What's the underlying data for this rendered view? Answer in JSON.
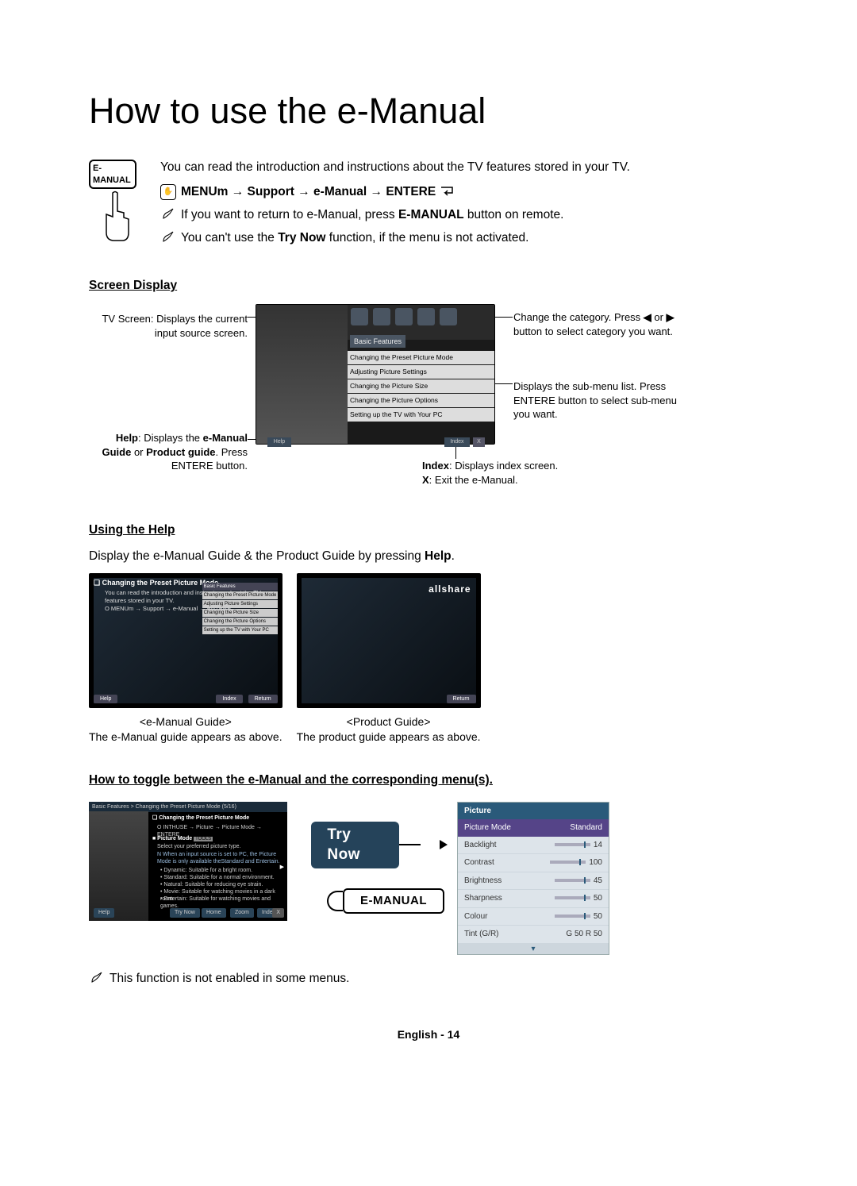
{
  "title": "How to use the e-Manual",
  "intro": "You can read the introduction and instructions about the TV features stored in your TV.",
  "badge": "E-MANUAL",
  "path": {
    "prefix": "O",
    "menu": "MENU",
    "m": "m",
    "arrow": " → ",
    "s1": "Support",
    "s2": "e-Manual",
    "enter": "ENTER",
    "e": "E"
  },
  "path_full": "MENUm → Support → e-Manual → ENTERE",
  "note1_a": "If you want to return to e-Manual, press ",
  "note1_b": "E-MANUAL",
  "note1_c": " button on remote.",
  "note2_a": "You can't use the ",
  "note2_b": "Try Now",
  "note2_c": " function, if the menu is not activated.",
  "sec1": "Screen Display",
  "basic": "Basic Features",
  "rows": {
    "r1": "Changing the Preset Picture Mode",
    "r2": "Adjusting Picture Settings",
    "r3": "Changing the Picture Size",
    "r4": "Changing the Picture Options",
    "r5": "Setting up the TV with Your PC"
  },
  "help_lbl": "Help",
  "index_lbl": "Index",
  "x_lbl": "X",
  "call_tv_a": "TV Screen: Displays the current input source screen.",
  "call_help_a": "Help",
  "call_help_b": ": Displays the ",
  "call_help_c": "e-Manual Guide",
  "call_help_d": " or ",
  "call_help_e": "Product guide",
  "call_help_f": ". Press ENTER",
  "call_help_g": "E",
  "call_help_h": " button.",
  "call_cat_a": "Change the category. Press ",
  "call_cat_b": "l",
  "call_cat_c": " or ",
  "call_cat_d": "r",
  "call_cat_e": " button to select category you want.",
  "call_sub_a": "Displays the sub-menu list. Press ENTER",
  "call_sub_b": "E",
  "call_sub_c": " button to select sub-menu you want.",
  "call_idx_a": "Index",
  "call_idx_b": ": Displays index screen.",
  "call_idx_c": "X",
  "call_idx_d": ": Exit the e-Manual.",
  "sec2": "Using the Help",
  "sec2_sub_a": "Display the e-Manual Guide & the Product Guide by pressing ",
  "sec2_sub_b": "Help",
  "sec2_sub_c": ".",
  "panelA": {
    "title": "❑ Changing the Preset Picture Mode",
    "txt": "You can read the introduction and instructions about the TV features stored in your TV.",
    "path": "O MENUm → Support → e-Manual → ENTERE",
    "bf": "Basic Features",
    "r1": "Changing the Preset Picture Mode",
    "r2": "Adjusting Picture Settings",
    "r3": "Changing the Picture Size",
    "r4": "Changing the Picture Options",
    "r5": "Setting up the TV with Your PC",
    "help": "Help",
    "index": "Index",
    "return": "Return"
  },
  "panelB": {
    "brand": "allshare",
    "return": "Return"
  },
  "capA_tag": "<e-Manual Guide>",
  "capA_txt": "The e-Manual guide appears as above.",
  "capB_tag": "<Product Guide>",
  "capB_txt": "The product guide appears as above.",
  "sec3": "How to toggle between the e-Manual and the corresponding menu(s).",
  "miniE": {
    "crumb": "Basic Features > Changing the Preset Picture Mode (5/16)",
    "t": "❑ Changing the Preset Picture Mode",
    "p": "O INTHUSE → Picture → Picture Mode → ENTERE",
    "h": "■ Picture Mode",
    "tool": "TOOLS",
    "sel": "Select your preferred picture type.",
    "note": "N When an input source is set to PC, the Picture Mode is only available theStandard and Entertain.",
    "b1": "• Dynamic: Suitable for a bright room.",
    "b2": "• Standard: Suitable for a normal environment.",
    "b3": "• Natural: Suitable for reducing eye strain.",
    "b4": "• Movie: Suitable for watching movies in a dark room.",
    "b5": "• Entertain: Suitable for watching movies and games.",
    "btn_try": "Try Now",
    "btn_home": "Home",
    "btn_zoom": "Zoom",
    "btn_index": "Index",
    "btn_x": "X",
    "btn_help": "Help"
  },
  "pill_try": "Try Now",
  "pill_em": "E-MANUAL",
  "osd": {
    "head": "Picture",
    "sel_l": "Picture Mode",
    "sel_r": "Standard",
    "r1_l": "Backlight",
    "r1_v": "14",
    "r2_l": "Contrast",
    "r2_v": "100",
    "r3_l": "Brightness",
    "r3_v": "45",
    "r4_l": "Sharpness",
    "r4_v": "50",
    "r5_l": "Colour",
    "r5_v": "50",
    "r6_l": "Tint (G/R)",
    "r6_v": "G 50          R 50"
  },
  "final_note": "This function is not enabled in some menus.",
  "footer": "English - 14"
}
